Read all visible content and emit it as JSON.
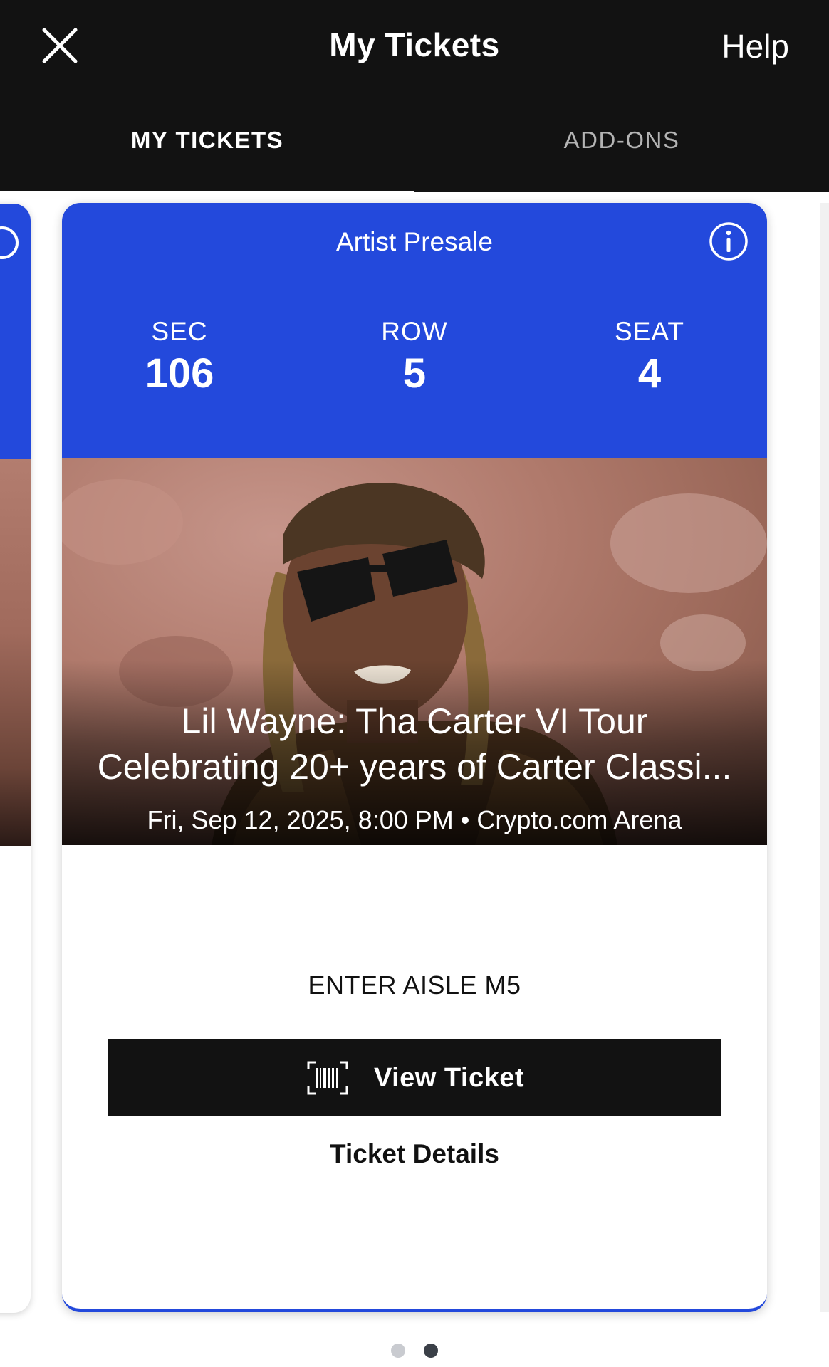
{
  "header": {
    "title": "My Tickets",
    "help_label": "Help",
    "close_icon": "close-icon"
  },
  "tabs": [
    {
      "label": "MY TICKETS",
      "active": true
    },
    {
      "label": "ADD-ONS",
      "active": false
    }
  ],
  "ticket": {
    "presale_type": "Artist Presale",
    "section_label": "SEC",
    "section_value": "106",
    "row_label": "ROW",
    "row_value": "5",
    "seat_label": "SEAT",
    "seat_value": "4",
    "event_title_line1": "Lil Wayne: Tha Carter VI Tour",
    "event_title_line2": "Celebrating 20+ years of Carter Classi...",
    "event_meta": "Fri, Sep 12, 2025, 8:00 PM • Crypto.com Arena",
    "aisle": "ENTER AISLE M5",
    "view_ticket_label": "View Ticket",
    "details_label": "Ticket Details",
    "accent_color": "#2349dc"
  },
  "pagination": {
    "total": 2,
    "active_index": 1
  }
}
